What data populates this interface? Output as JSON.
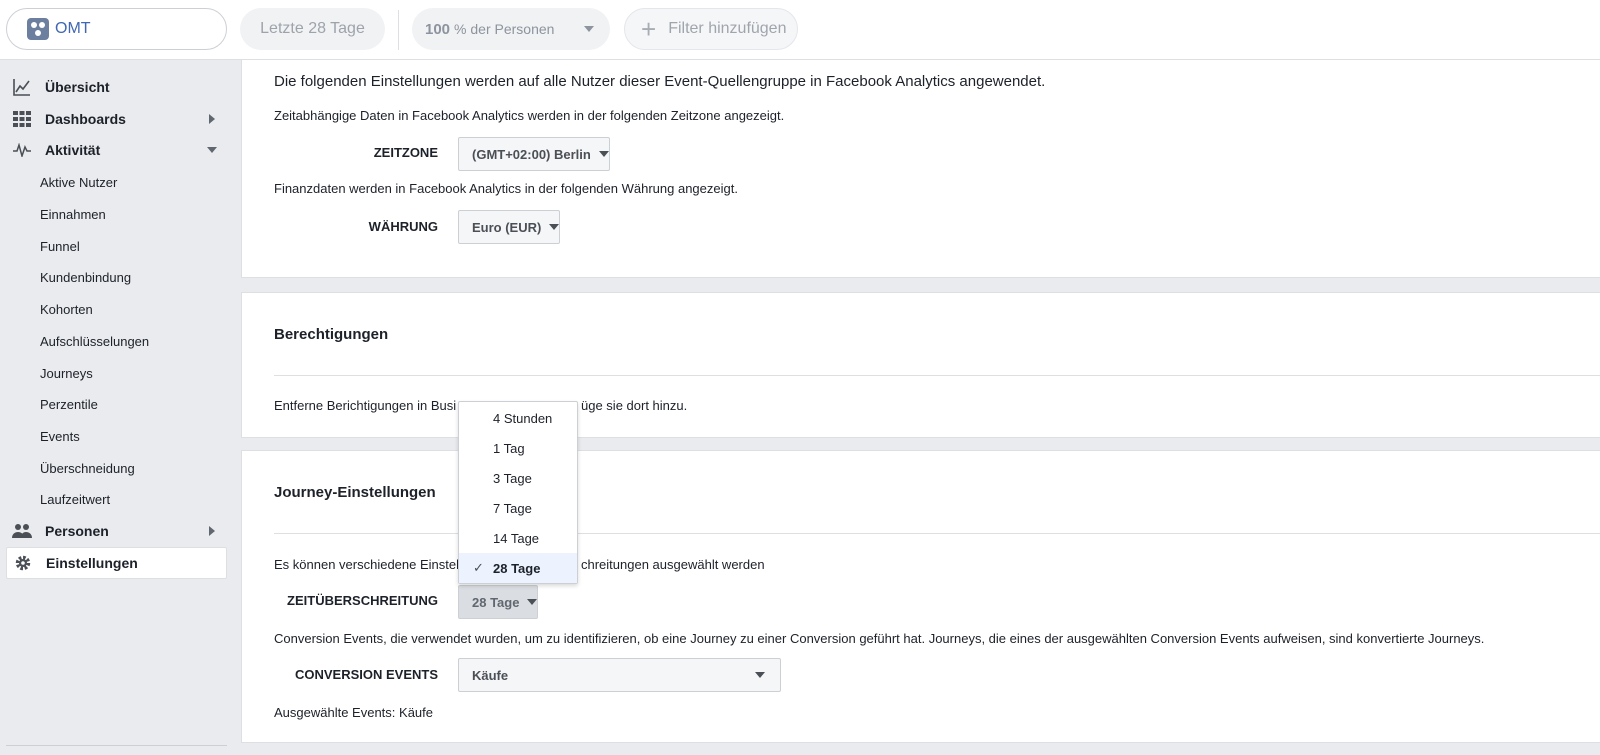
{
  "topbar": {
    "app_name": "OMT",
    "date_range": "Letzte 28 Tage",
    "persons_value": "100",
    "persons_suffix": "% der Personen",
    "filter_label": "Filter hinzufügen"
  },
  "sidebar": {
    "items": [
      {
        "label": "Übersicht",
        "icon": "chart-line-icon"
      },
      {
        "label": "Dashboards",
        "icon": "grid-icon"
      },
      {
        "label": "Aktivität",
        "icon": "activity-pulse-icon"
      },
      {
        "label": "Aktive Nutzer"
      },
      {
        "label": "Einnahmen"
      },
      {
        "label": "Funnel"
      },
      {
        "label": "Kundenbindung"
      },
      {
        "label": "Kohorten"
      },
      {
        "label": "Aufschlüsselungen"
      },
      {
        "label": "Journeys"
      },
      {
        "label": "Perzentile"
      },
      {
        "label": "Events"
      },
      {
        "label": "Überschneidung"
      },
      {
        "label": "Laufzeitwert"
      },
      {
        "label": "Personen",
        "icon": "people-icon"
      },
      {
        "label": "Einstellungen",
        "icon": "gear-icon"
      }
    ]
  },
  "settings": {
    "intro": "Die folgenden Einstellungen werden auf alle Nutzer dieser Event-Quellengruppe in Facebook Analytics angewendet.",
    "timezone_desc": "Zeitabhängige Daten in Facebook Analytics werden in der folgenden Zeitzone angezeigt.",
    "timezone_label": "ZEITZONE",
    "timezone_value": "(GMT+02:00) Berlin",
    "currency_desc": "Finanzdaten werden in Facebook Analytics in der folgenden Währung angezeigt.",
    "currency_label": "WÄHRUNG",
    "currency_value": "Euro (EUR)"
  },
  "permissions": {
    "title": "Berechtigungen",
    "desc_start": "Entferne Berichtigungen in Busi",
    "desc_end": "üge sie dort hinzu."
  },
  "journey": {
    "title": "Journey-Einstellungen",
    "desc_start": "Es können verschiedene Einstel",
    "desc_end": "chreitungen ausgewählt werden",
    "timeout_label": "ZEITÜBERSCHREITUNG",
    "timeout_value": "28 Tage",
    "conversion_desc": "Conversion Events, die verwendet wurden, um zu identifizieren, ob eine Journey zu einer Conversion geführt hat. Journeys, die eines der ausgewählten Conversion Events aufweisen, sind konvertierte Journeys.",
    "conversion_label": "CONVERSION EVENTS",
    "conversion_value": "Käufe",
    "selected_events": "Ausgewählte Events: Käufe"
  },
  "dropdown": {
    "options": [
      "4 Stunden",
      "1 Tag",
      "3 Tage",
      "7 Tage",
      "14 Tage",
      "28 Tage"
    ],
    "selected": "28 Tage"
  }
}
